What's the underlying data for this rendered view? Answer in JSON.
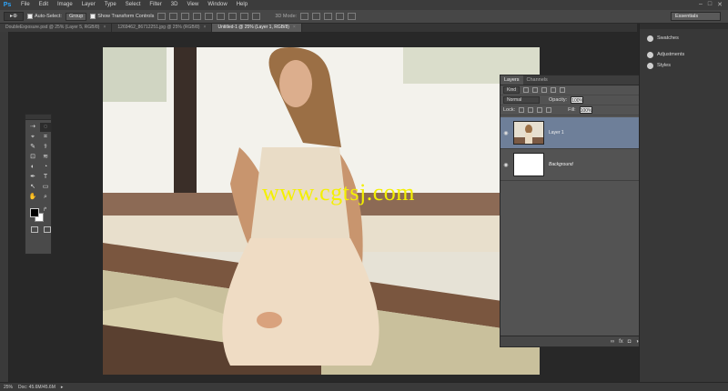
{
  "app": {
    "logo": "Ps"
  },
  "menu": [
    "File",
    "Edit",
    "Image",
    "Layer",
    "Type",
    "Select",
    "Filter",
    "3D",
    "View",
    "Window",
    "Help"
  ],
  "window_controls": [
    "–",
    "□",
    "✕"
  ],
  "options": {
    "tool_preset": "▸⊕",
    "auto_select_label": "Auto-Select:",
    "auto_select_value": "Group",
    "show_transform_label": "Show Transform Controls",
    "mode_3d_label": "3D Mode:",
    "workspace": "Essentials"
  },
  "tabs": [
    {
      "label": "DoubleExposure.psd @ 25% (Layer 5, RGB/8)",
      "close": "×"
    },
    {
      "label": "1269462_86712251.jpg @ 25% (RGB/8)",
      "close": "×"
    },
    {
      "label": "Untitled-1 @ 25% (Layer 1, RGB/8)",
      "close": "×"
    }
  ],
  "watermark": "www.cgtsj.com",
  "tools": [
    "⇢",
    "◌",
    "⌖",
    "⌗",
    "✎",
    "⚕",
    "⊡",
    "≋",
    "◐",
    "◔",
    "✒",
    "T",
    "↖",
    "▭",
    "✋",
    "⌕"
  ],
  "swap_glyph": "↱",
  "layers_panel": {
    "tabs": [
      "Layers",
      "Channels"
    ],
    "kind_filter": "Kind",
    "blend_mode": "Normal",
    "opacity_label": "Opacity:",
    "opacity_value": "100%",
    "lock_label": "Lock:",
    "fill_label": "Fill:",
    "fill_value": "100%",
    "eye_glyph": "◉",
    "lock_glyph": "🔒",
    "layers": [
      {
        "name": "Layer 1",
        "selected": true
      },
      {
        "name": "Background",
        "selected": false
      }
    ],
    "footer_icons": [
      "∞",
      "fx",
      "◘",
      "◑",
      "▭",
      "▤",
      "🗑"
    ]
  },
  "right_dock": [
    {
      "label": "Swatches",
      "icon": "swatches-icon"
    },
    {
      "label": "Adjustments",
      "icon": "adjustments-icon"
    },
    {
      "label": "Styles",
      "icon": "styles-icon"
    }
  ],
  "status": {
    "zoom": "25%",
    "doc": "Doc: 45.6M/45.6M",
    "arrow": "▸"
  }
}
